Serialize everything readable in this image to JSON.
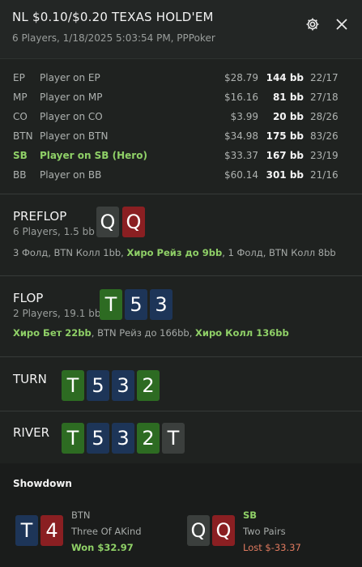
{
  "header": {
    "title": "NL $0.10/$0.20 TEXAS HOLD'EM",
    "subtitle": "6 Players, 1/18/2025 5:03:54 PM, PPPoker",
    "gear_icon": "gear-icon",
    "close_icon": "close-icon"
  },
  "players": [
    {
      "pos": "EP",
      "name": "Player on EP",
      "stack": "$28.79",
      "bb": "144 bb",
      "stat": "22/17",
      "hero": false
    },
    {
      "pos": "MP",
      "name": "Player on MP",
      "stack": "$16.16",
      "bb": "81 bb",
      "stat": "27/18",
      "hero": false
    },
    {
      "pos": "CO",
      "name": "Player on CO",
      "stack": "$3.99",
      "bb": "20 bb",
      "stat": "28/26",
      "hero": false
    },
    {
      "pos": "BTN",
      "name": "Player on BTN",
      "stack": "$34.98",
      "bb": "175 bb",
      "stat": "83/26",
      "hero": false
    },
    {
      "pos": "SB",
      "name": "Player on SB (Hero)",
      "stack": "$33.37",
      "bb": "167 bb",
      "stat": "23/19",
      "hero": true
    },
    {
      "pos": "BB",
      "name": "Player on BB",
      "stack": "$60.14",
      "bb": "301 bb",
      "stat": "21/16",
      "hero": false
    }
  ],
  "preflop": {
    "title": "PREFLOP",
    "sub": "6 Players, 1.5 bb",
    "cards": [
      {
        "rank": "Q",
        "suit": "s"
      },
      {
        "rank": "Q",
        "suit": "h"
      }
    ],
    "actions": [
      {
        "text": "3 Фолд, BTN Колл 1bb, ",
        "hero": false
      },
      {
        "text": "Хиро Рейз до 9bb",
        "hero": true
      },
      {
        "text": ", 1 Фолд, BTN Колл 8bb",
        "hero": false
      }
    ]
  },
  "flop": {
    "title": "FLOP",
    "sub": "2 Players, 19.1 bb",
    "cards": [
      {
        "rank": "T",
        "suit": "c"
      },
      {
        "rank": "5",
        "suit": "d"
      },
      {
        "rank": "3",
        "suit": "d"
      }
    ],
    "actions": [
      {
        "text": "Хиро Бет 22bb",
        "hero": true
      },
      {
        "text": ", BTN Рейз до 166bb, ",
        "hero": false
      },
      {
        "text": "Хиро Колл 136bb",
        "hero": true
      }
    ]
  },
  "turn": {
    "title": "TURN",
    "cards": [
      {
        "rank": "T",
        "suit": "c"
      },
      {
        "rank": "5",
        "suit": "d"
      },
      {
        "rank": "3",
        "suit": "d"
      },
      {
        "rank": "2",
        "suit": "c"
      }
    ]
  },
  "river": {
    "title": "RIVER",
    "cards": [
      {
        "rank": "T",
        "suit": "c"
      },
      {
        "rank": "5",
        "suit": "d"
      },
      {
        "rank": "3",
        "suit": "d"
      },
      {
        "rank": "2",
        "suit": "c"
      },
      {
        "rank": "T",
        "suit": "s"
      }
    ]
  },
  "showdown": {
    "title": "Showdown",
    "players": [
      {
        "pos": "BTN",
        "hand": "Three Of AKind",
        "result": "Won $32.97",
        "won": true,
        "cards": [
          {
            "rank": "T",
            "suit": "d"
          },
          {
            "rank": "4",
            "suit": "h"
          }
        ]
      },
      {
        "pos": "SB",
        "hand": "Two Pairs",
        "result": "Lost $-33.37",
        "won": false,
        "hero": true,
        "cards": [
          {
            "rank": "Q",
            "suit": "s"
          },
          {
            "rank": "Q",
            "suit": "h"
          }
        ]
      }
    ]
  },
  "colors": {
    "background": "#1f2220",
    "hero_green": "#8fd067",
    "lost": "#e07a5f",
    "suit_spade": "#3b3f3d",
    "suit_heart": "#8a1f22",
    "suit_diamond": "#1d3558",
    "suit_club": "#2d6b22"
  }
}
